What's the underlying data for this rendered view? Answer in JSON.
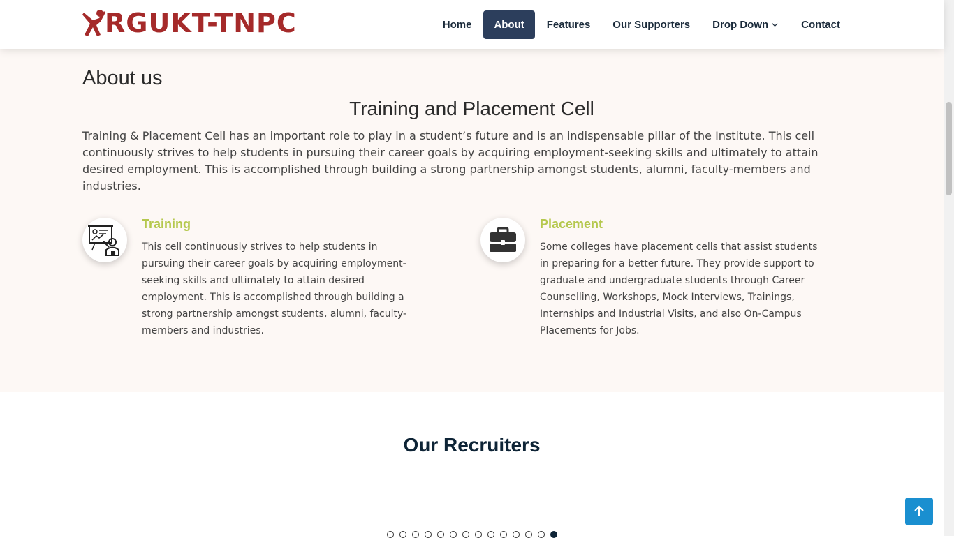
{
  "brand": {
    "name": "RGUKT-TNPC",
    "color": "#a52a2a"
  },
  "nav": {
    "items": [
      {
        "label": "Home"
      },
      {
        "label": "About",
        "active": true
      },
      {
        "label": "Features"
      },
      {
        "label": "Our Supporters"
      },
      {
        "label": "Drop Down",
        "icon": "chevron-down-icon"
      },
      {
        "label": "Contact"
      }
    ]
  },
  "about": {
    "title": "About us",
    "subtitle": "Training and Placement Cell",
    "description": "Training & Placement Cell has an important role to play in a student’s future and is an indispensable pillar of the Institute. This cell continuously strives to help students in pursuing their career goals by acquiring employment-seeking skills and ultimately to attain desired employment. This is accomplished through building a strong partnership amongst students, alumni, faculty-members and industries.",
    "features": [
      {
        "title": "Training",
        "icon": "training-presentation-icon",
        "text": "This cell continuously strives to help students in pursuing their career goals by acquiring employment-seeking skills and ultimately to attain desired employment. This is accomplished through building a strong partnership amongst students, alumni, faculty-members and industries."
      },
      {
        "title": "Placement",
        "icon": "briefcase-icon",
        "text": "Some colleges have placement cells that assist students in preparing for a better future. They provide support to graduate and undergraduate students through Career Counselling, Workshops, Mock Interviews, Trainings, Internships and Industrial Visits, and also On-Campus Placements for Jobs."
      }
    ]
  },
  "recruiters": {
    "title": "Our Recruiters",
    "carousel_dots": 14,
    "active_dot": 14
  },
  "back_to_top": {
    "icon": "arrow-up-icon"
  },
  "colors": {
    "accent": "#2c3e5c",
    "feature_title": "#b5c84e",
    "section_bg": "#fdf8f5",
    "back_to_top": "#1a8fd0"
  }
}
